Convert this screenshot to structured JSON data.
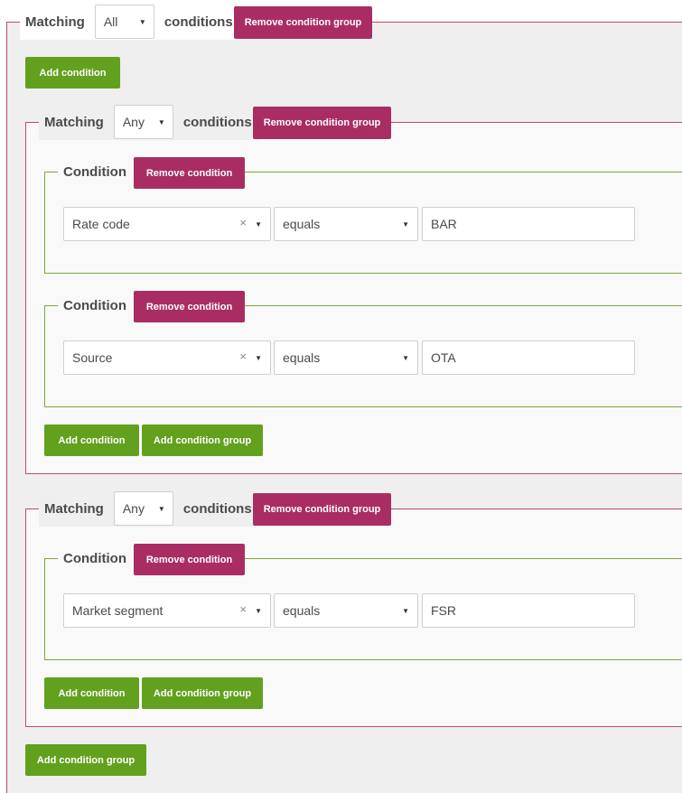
{
  "labels": {
    "matching": "Matching",
    "conditions": "conditions",
    "condition": "Condition",
    "remove_condition_group": "Remove condition group",
    "remove_condition": "Remove condition",
    "add_condition": "Add condition",
    "add_condition_group": "Add condition group",
    "clear": "×",
    "caret": "▼"
  },
  "root": {
    "match_value": "All"
  },
  "groups": [
    {
      "match_value": "Any",
      "conditions": [
        {
          "field": "Rate code",
          "operator": "equals",
          "value": "BAR"
        },
        {
          "field": "Source",
          "operator": "equals",
          "value": "OTA"
        }
      ]
    },
    {
      "match_value": "Any",
      "conditions": [
        {
          "field": "Market segment",
          "operator": "equals",
          "value": "FSR"
        }
      ]
    }
  ]
}
